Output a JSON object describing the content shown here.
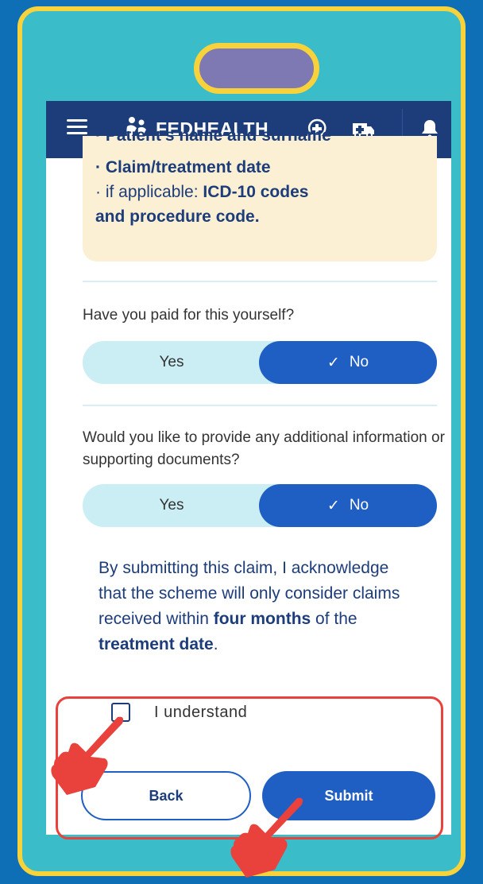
{
  "app": {
    "brand": "FEDHEALTH",
    "icons": [
      "menu-icon",
      "fedhealth-logo-icon",
      "health-chat-icon",
      "ambulance-icon",
      "bell-icon"
    ]
  },
  "info_box": {
    "line_cut": "· Patient's name and surname",
    "line1": "· Claim/treatment date",
    "line2_prefix": "· if applicable: ",
    "line2_bold": "ICD-10 codes",
    "line3": "and procedure code."
  },
  "q1": {
    "text": "Have you paid for this yourself?",
    "yes": "Yes",
    "no": "No",
    "selected": "No"
  },
  "q2": {
    "text": "Would you like to provide any additional information or supporting documents?",
    "yes": "Yes",
    "no": "No",
    "selected": "No"
  },
  "acknowledgement": {
    "part1": "By submitting this claim, I acknowledge that the scheme will only consider claims received within ",
    "bold1": "four months",
    "part2": " of the ",
    "bold2": "treatment date",
    "part3": "."
  },
  "checkbox": {
    "label": "I understand",
    "checked": false
  },
  "buttons": {
    "back": "Back",
    "submit": "Submit"
  },
  "colors": {
    "background": "#0f6fb6",
    "frame": "#3bbcc9",
    "frame_border": "#f7d23a",
    "navbar": "#1d3c7a",
    "primary": "#1f5fc4",
    "highlight": "#e9413b"
  }
}
